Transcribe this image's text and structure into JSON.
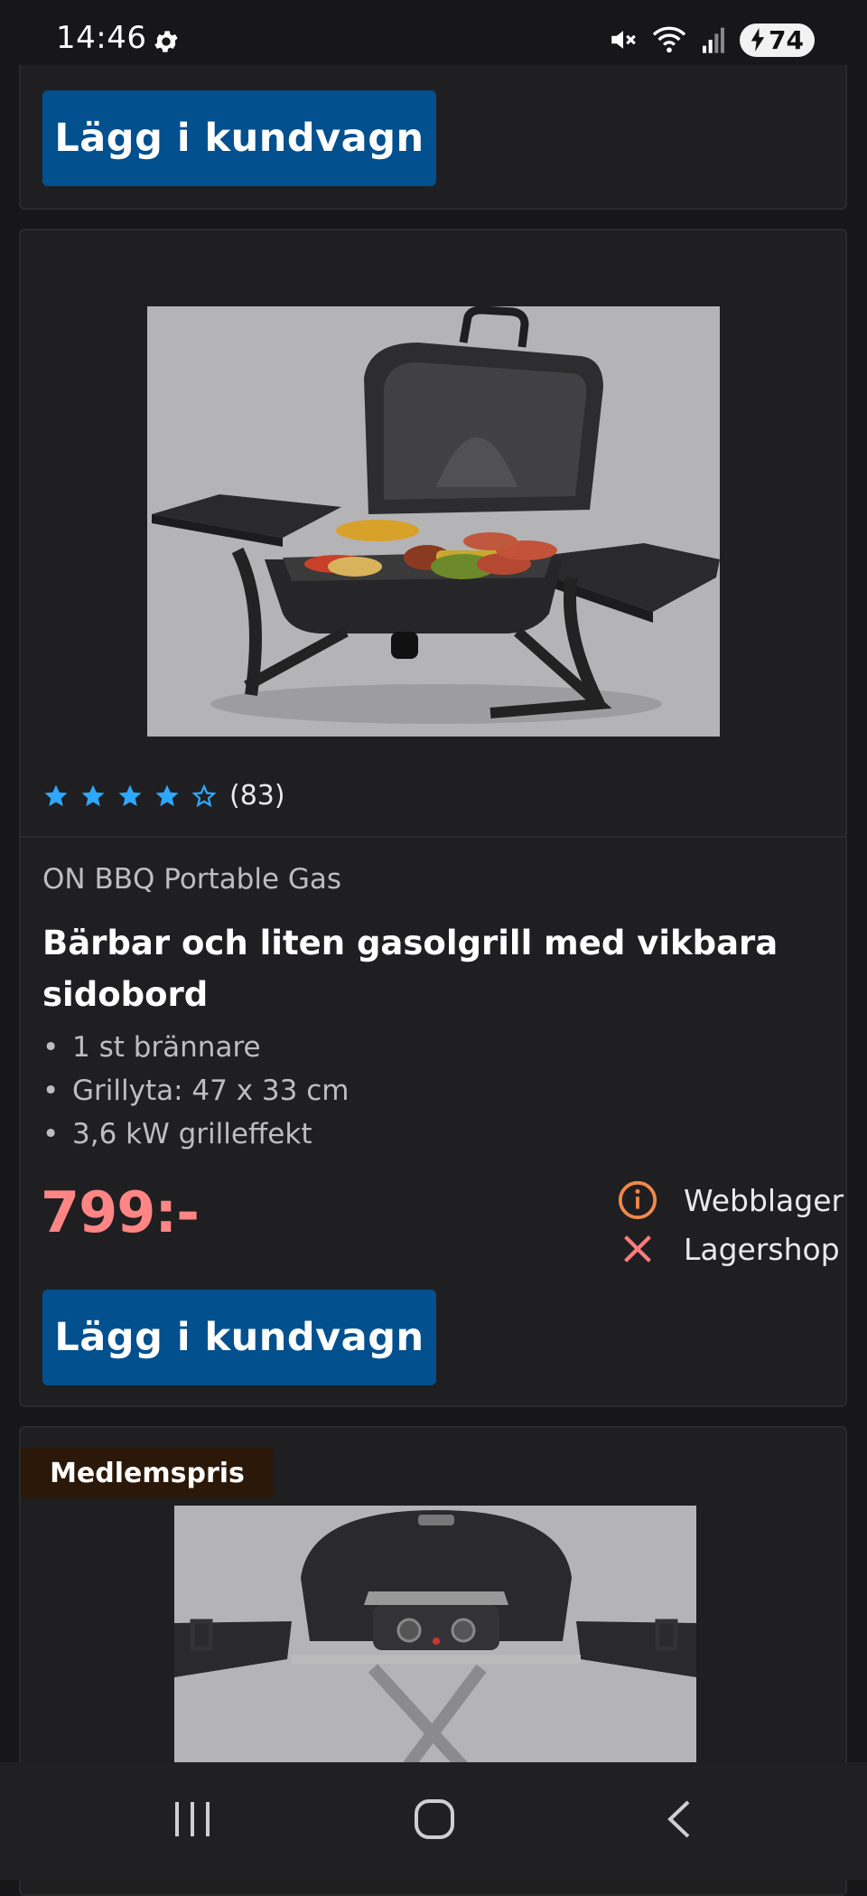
{
  "status_bar": {
    "time": "14:46",
    "battery": "74"
  },
  "top_card": {
    "cart_label": "Lägg i kundvagn"
  },
  "product": {
    "rating": {
      "stars": 4,
      "max": 5,
      "count": "(83)"
    },
    "brand": "ON BBQ Portable Gas",
    "title": "Bärbar och liten gasolgrill med vikbara sidobord",
    "bullets": [
      "1 st brännare",
      "Grillyta: 47 x 33 cm",
      "3,6 kW grilleffekt"
    ],
    "price": "799:-",
    "stock": [
      {
        "label": "Webblager",
        "icon": "info-circle-icon",
        "color": "#f2894a"
      },
      {
        "label": "Lagershop",
        "icon": "close-x-icon",
        "color": "#ff7c7c"
      }
    ],
    "cart_label": "Lägg i kundvagn"
  },
  "next_product": {
    "badge": "Medlemspris"
  },
  "colors": {
    "accent_button": "#03508f",
    "price": "#ff8585",
    "star": "#2ea8ff"
  }
}
